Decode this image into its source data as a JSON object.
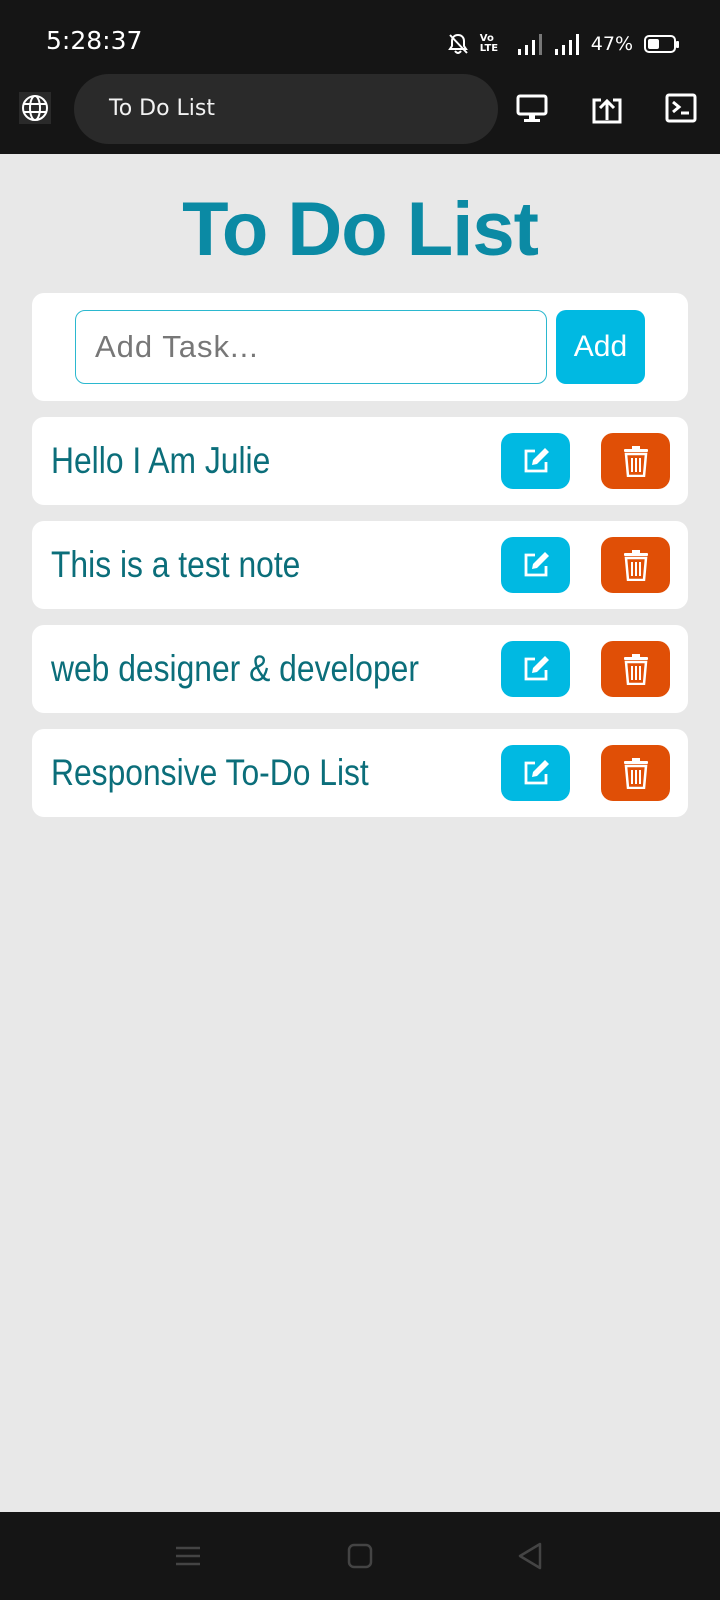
{
  "status_bar": {
    "time": "5:28:37",
    "volte_line1": "Vo",
    "volte_line2": "LTE",
    "battery_percent": "47%",
    "battery_level": 0.47
  },
  "browser": {
    "url_title": "To Do List",
    "icons": [
      "globe-icon",
      "desktop-icon",
      "share-upload-icon",
      "terminal-icon"
    ]
  },
  "app": {
    "title": "To Do List",
    "input_placeholder": "Add Task...",
    "input_value": "",
    "add_label": "Add",
    "tasks": [
      {
        "text": "Hello I Am Julie"
      },
      {
        "text": "This is a test note"
      },
      {
        "text": "web designer & developer"
      },
      {
        "text": "Responsive To-Do List"
      }
    ]
  },
  "colors": {
    "title": "#0b8aa4",
    "task_text": "#0b6e7a",
    "edit_button": "#00b9e2",
    "delete_button": "#e04f06",
    "background": "#e8e8e8"
  },
  "nav_bar": {
    "icons": [
      "menu-icon",
      "home-icon",
      "back-icon"
    ]
  }
}
